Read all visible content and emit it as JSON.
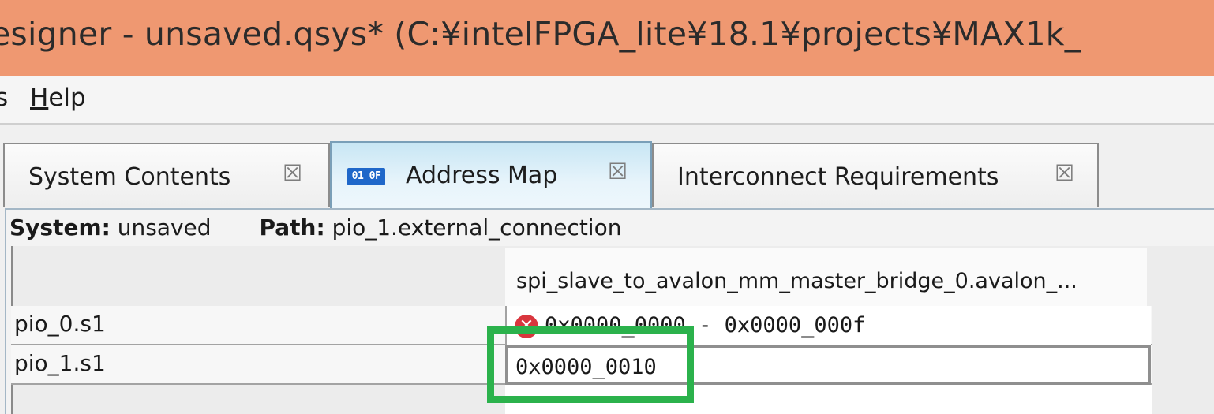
{
  "window": {
    "title": "esigner - unsaved.qsys* (C:¥intelFPGA_lite¥18.1¥projects¥MAX1k_"
  },
  "menubar": {
    "items": [
      {
        "label": "s",
        "clipped": true
      },
      {
        "label": "Help",
        "mnemonic": "H"
      }
    ]
  },
  "tabs": [
    {
      "label": "System Contents",
      "close": "☒",
      "active": false
    },
    {
      "label": "Address Map",
      "close": "☒",
      "active": true,
      "icon": "address-map-icon",
      "icon_text": "01 0F"
    },
    {
      "label": "Interconnect Requirements",
      "close": "☒",
      "active": false
    }
  ],
  "pathbar": {
    "system_label": "System:",
    "system_value": "unsaved",
    "path_label": "Path:",
    "path_value": "pio_1.external_connection"
  },
  "address_map": {
    "column_header": "spi_slave_to_avalon_mm_master_bridge_0.avalon_...",
    "rows": [
      {
        "name": "pio_0.s1",
        "value": "0x0000_0000  -  0x0000_000f",
        "error": true
      },
      {
        "name": "pio_1.s1",
        "value": "0x0000_0010",
        "editing": true
      }
    ]
  },
  "colors": {
    "titlebar": "#ef9871",
    "active_tab": "#c8e6f4",
    "highlight": "#2bb24c",
    "error": "#d9363e"
  }
}
